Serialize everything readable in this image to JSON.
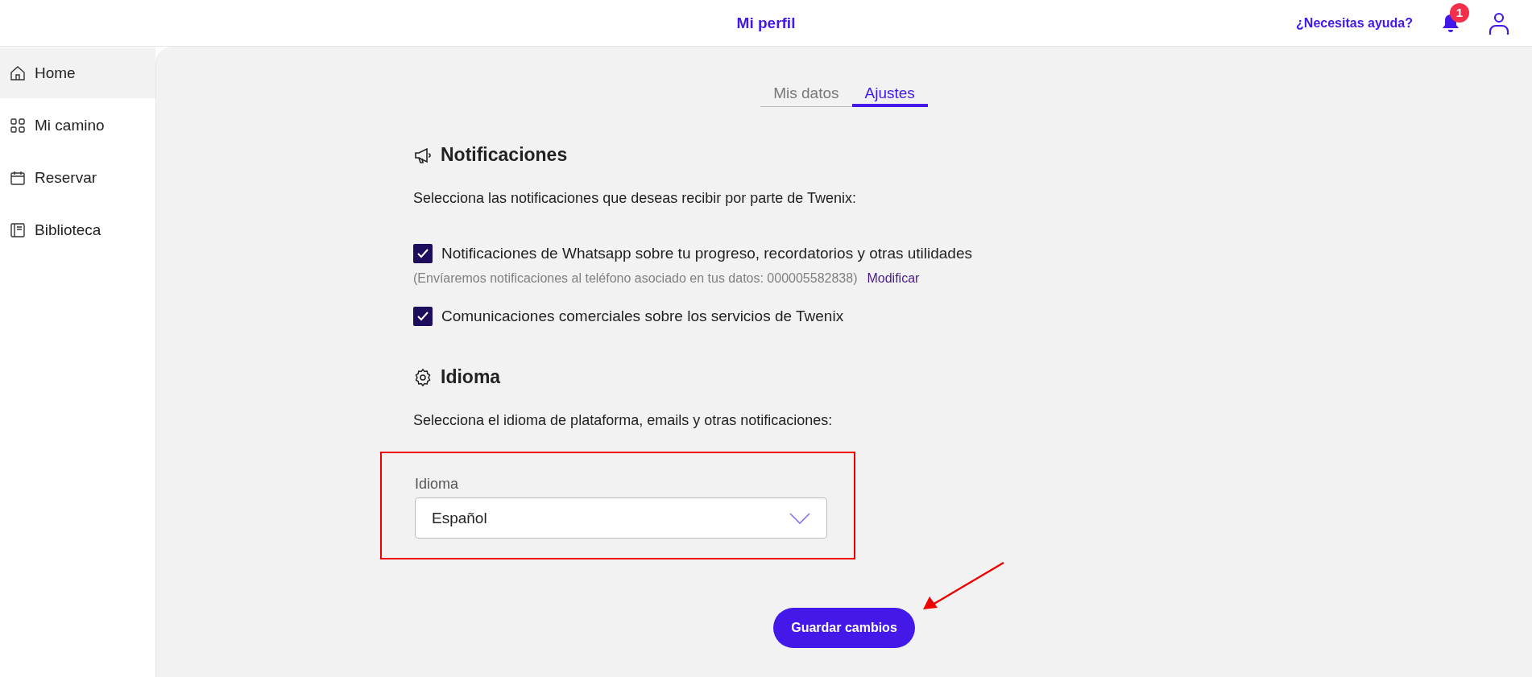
{
  "header": {
    "title": "Mi perfil",
    "help_link": "¿Necesitas ayuda?",
    "notification_count": "1"
  },
  "sidebar": {
    "items": [
      {
        "label": "Home",
        "selected": true
      },
      {
        "label": "Mi camino",
        "selected": false
      },
      {
        "label": "Reservar",
        "selected": false
      },
      {
        "label": "Biblioteca",
        "selected": false
      }
    ]
  },
  "tabs": [
    {
      "label": "Mis datos",
      "selected": false
    },
    {
      "label": "Ajustes",
      "selected": true
    }
  ],
  "notifications": {
    "heading": "Notificaciones",
    "intro": "Selecciona las notificaciones que deseas recibir por parte de Twenix:",
    "options": [
      {
        "label": "Notificaciones de Whatsapp sobre tu progreso, recordatorios y otras utilidades",
        "checked": true,
        "note": "(Envíaremos notificaciones al teléfono asociado en tus datos: 000005582838)",
        "note_link": "Modificar"
      },
      {
        "label": "Comunicaciones comerciales sobre los servicios de Twenix",
        "checked": true
      }
    ]
  },
  "language": {
    "heading": "Idioma",
    "intro": "Selecciona el idioma de plataforma, emails y otras notificaciones:",
    "field_label": "Idioma",
    "value": "Español"
  },
  "save_button": "Guardar cambios"
}
